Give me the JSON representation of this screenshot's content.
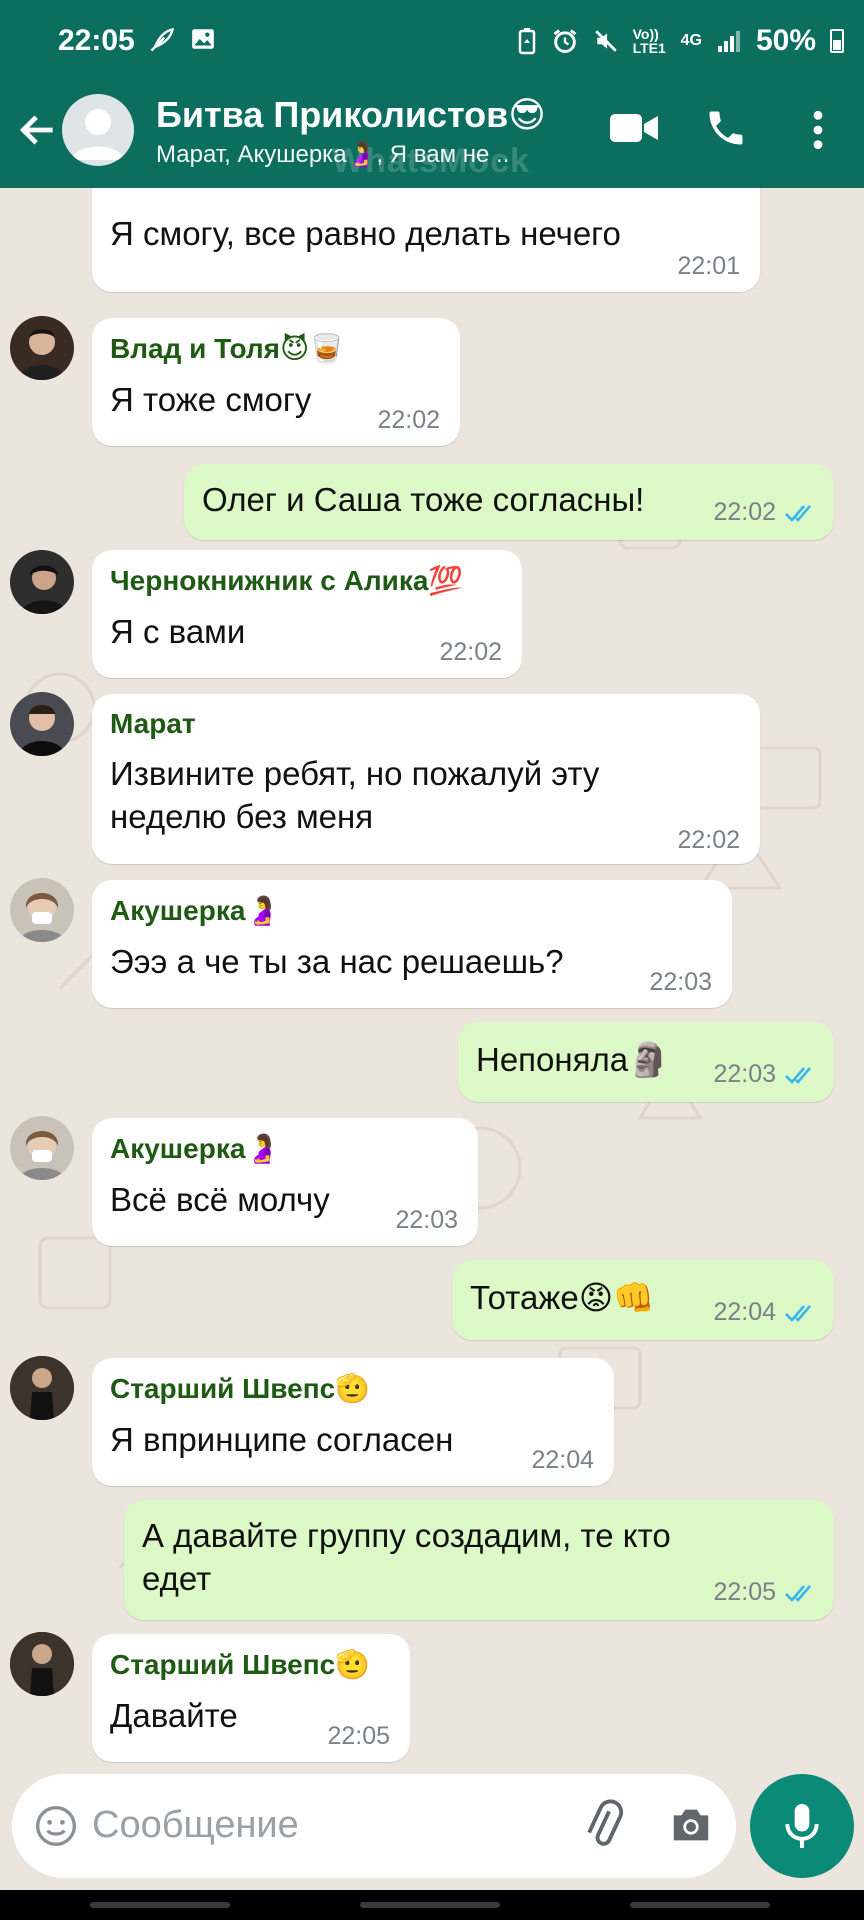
{
  "status_bar": {
    "time": "22:05",
    "left_icons": [
      "feather-icon",
      "image-icon"
    ],
    "right_icons": [
      "battery-saver-icon",
      "alarm-icon",
      "mute-icon",
      "volte-icon",
      "4g-icon",
      "signal-icon"
    ],
    "volte": "Vo)) LTE1",
    "net": "4G",
    "battery": "50%"
  },
  "header": {
    "title": "Битва Приколистов😎",
    "subtitle": "Марат, Акушерка🤰, Я вам не ..",
    "watermark": "WhatsMock",
    "icons": [
      "back-arrow-icon",
      "video-call-icon",
      "phone-icon",
      "more-icon"
    ]
  },
  "messages": [
    {
      "dir": "in",
      "text": [
        "Я смогу, все равно делать нечего"
      ],
      "time": "22:01"
    },
    {
      "dir": "in",
      "sender": "Влад и Толя😈🥃",
      "text": [
        "Я тоже смогу"
      ],
      "time": "22:02"
    },
    {
      "dir": "out",
      "text": [
        "Олег и Саша тоже согласны!"
      ],
      "time": "22:02"
    },
    {
      "dir": "in",
      "sender": "Чернокнижник с Алика💯",
      "text": [
        "Я с вами"
      ],
      "time": "22:02"
    },
    {
      "dir": "in",
      "sender": "Марат",
      "text": [
        "Извините ребят, но пожалуй эту",
        "неделю без меня"
      ],
      "time": "22:02"
    },
    {
      "dir": "in",
      "sender": "Акушерка🤰",
      "text": [
        "Эээ а че ты за нас решаешь?"
      ],
      "time": "22:03"
    },
    {
      "dir": "out",
      "text": [
        "Непоняла🗿"
      ],
      "time": "22:03"
    },
    {
      "dir": "in",
      "sender": "Акушерка🤰",
      "text": [
        "Всё всё молчу"
      ],
      "time": "22:03"
    },
    {
      "dir": "out",
      "text": [
        "Тотаже😡👊"
      ],
      "time": "22:04"
    },
    {
      "dir": "in",
      "sender": "Старший Швепс🫡",
      "text": [
        "Я впринципе согласен"
      ],
      "time": "22:04"
    },
    {
      "dir": "out",
      "text": [
        "А давайте группу создадим, те кто",
        "едет"
      ],
      "time": "22:05"
    },
    {
      "dir": "in",
      "sender": "Старший Швепс🫡",
      "text": [
        "Давайте"
      ],
      "time": "22:05"
    }
  ],
  "input": {
    "placeholder": "Сообщение",
    "icons": [
      "emoji-icon",
      "attach-icon",
      "camera-icon",
      "mic-icon"
    ]
  },
  "colors": {
    "header": "#0B6E5F",
    "incoming": "#FFFFFF",
    "outgoing": "#DCF8C6",
    "sender": "#1E5A13",
    "read_ticks": "#34B7F1",
    "background": "#ECE5DD",
    "mic": "#0B8A77"
  }
}
